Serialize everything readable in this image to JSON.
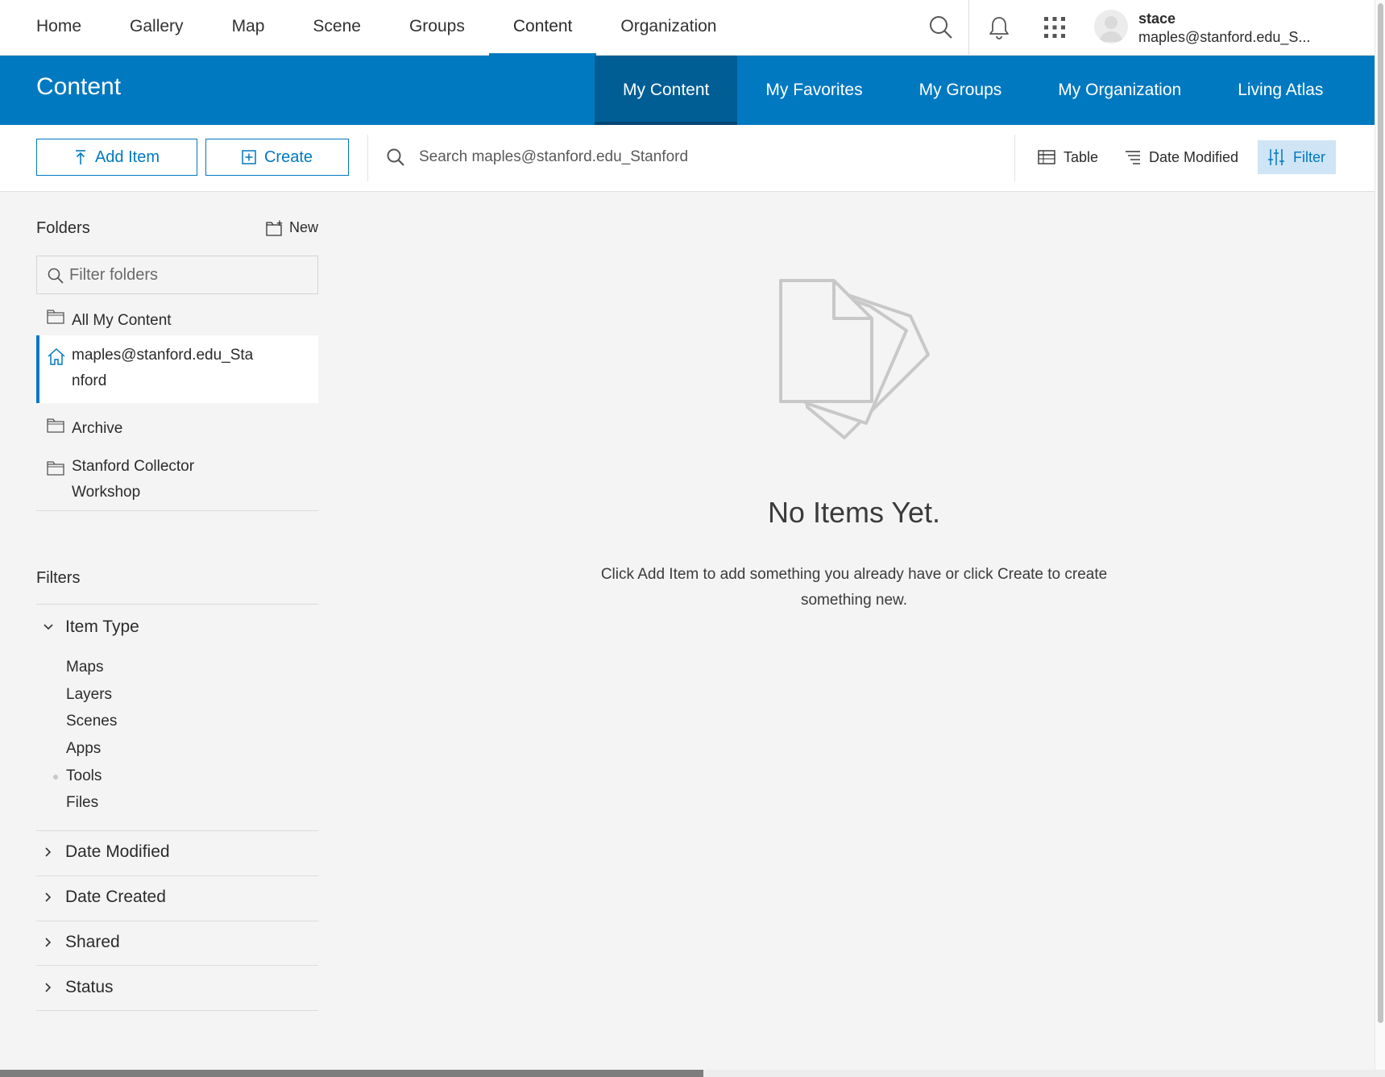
{
  "topnav": {
    "links": [
      "Home",
      "Gallery",
      "Map",
      "Scene",
      "Groups",
      "Content",
      "Organization"
    ],
    "active": "Content",
    "user": {
      "name": "stace",
      "id": "maples@stanford.edu_S..."
    },
    "icons": {
      "search": "search-icon",
      "notifications": "bell-icon",
      "apps": "app-grid-icon",
      "avatar": "user-avatar-icon"
    }
  },
  "header": {
    "title": "Content",
    "tabs": [
      "My Content",
      "My Favorites",
      "My Groups",
      "My Organization",
      "Living Atlas"
    ],
    "active_tab": "My Content"
  },
  "toolbar": {
    "add_item_label": "Add Item",
    "create_label": "Create",
    "search_placeholder": "Search maples@stanford.edu_Stanford",
    "view_label": "Table",
    "sort_label": "Date Modified",
    "filter_label": "Filter"
  },
  "sidebar": {
    "folders_title": "Folders",
    "new_label": "New",
    "filter_placeholder": "Filter folders",
    "folders": [
      {
        "label": "All My Content",
        "icon": "folder-icon"
      },
      {
        "label": "maples@stanford.edu_Stanford",
        "icon": "home-icon",
        "selected": true
      },
      {
        "label": "Archive",
        "icon": "folder-icon"
      },
      {
        "label": "Stanford Collector Workshop",
        "icon": "folder-icon"
      }
    ],
    "filters_title": "Filters",
    "item_type": {
      "label": "Item Type",
      "expanded": true,
      "options": [
        "Maps",
        "Layers",
        "Scenes",
        "Apps",
        "Tools",
        "Files"
      ]
    },
    "collapsed_filters": [
      "Date Modified",
      "Date Created",
      "Shared",
      "Status"
    ]
  },
  "empty_state": {
    "title": "No Items Yet.",
    "description": "Click Add Item to add something you already have or click Create to create something new."
  },
  "colors": {
    "brand_blue": "#0079c1",
    "active_tab_bg": "#005e95",
    "filter_active_bg": "#cfe4f4"
  }
}
